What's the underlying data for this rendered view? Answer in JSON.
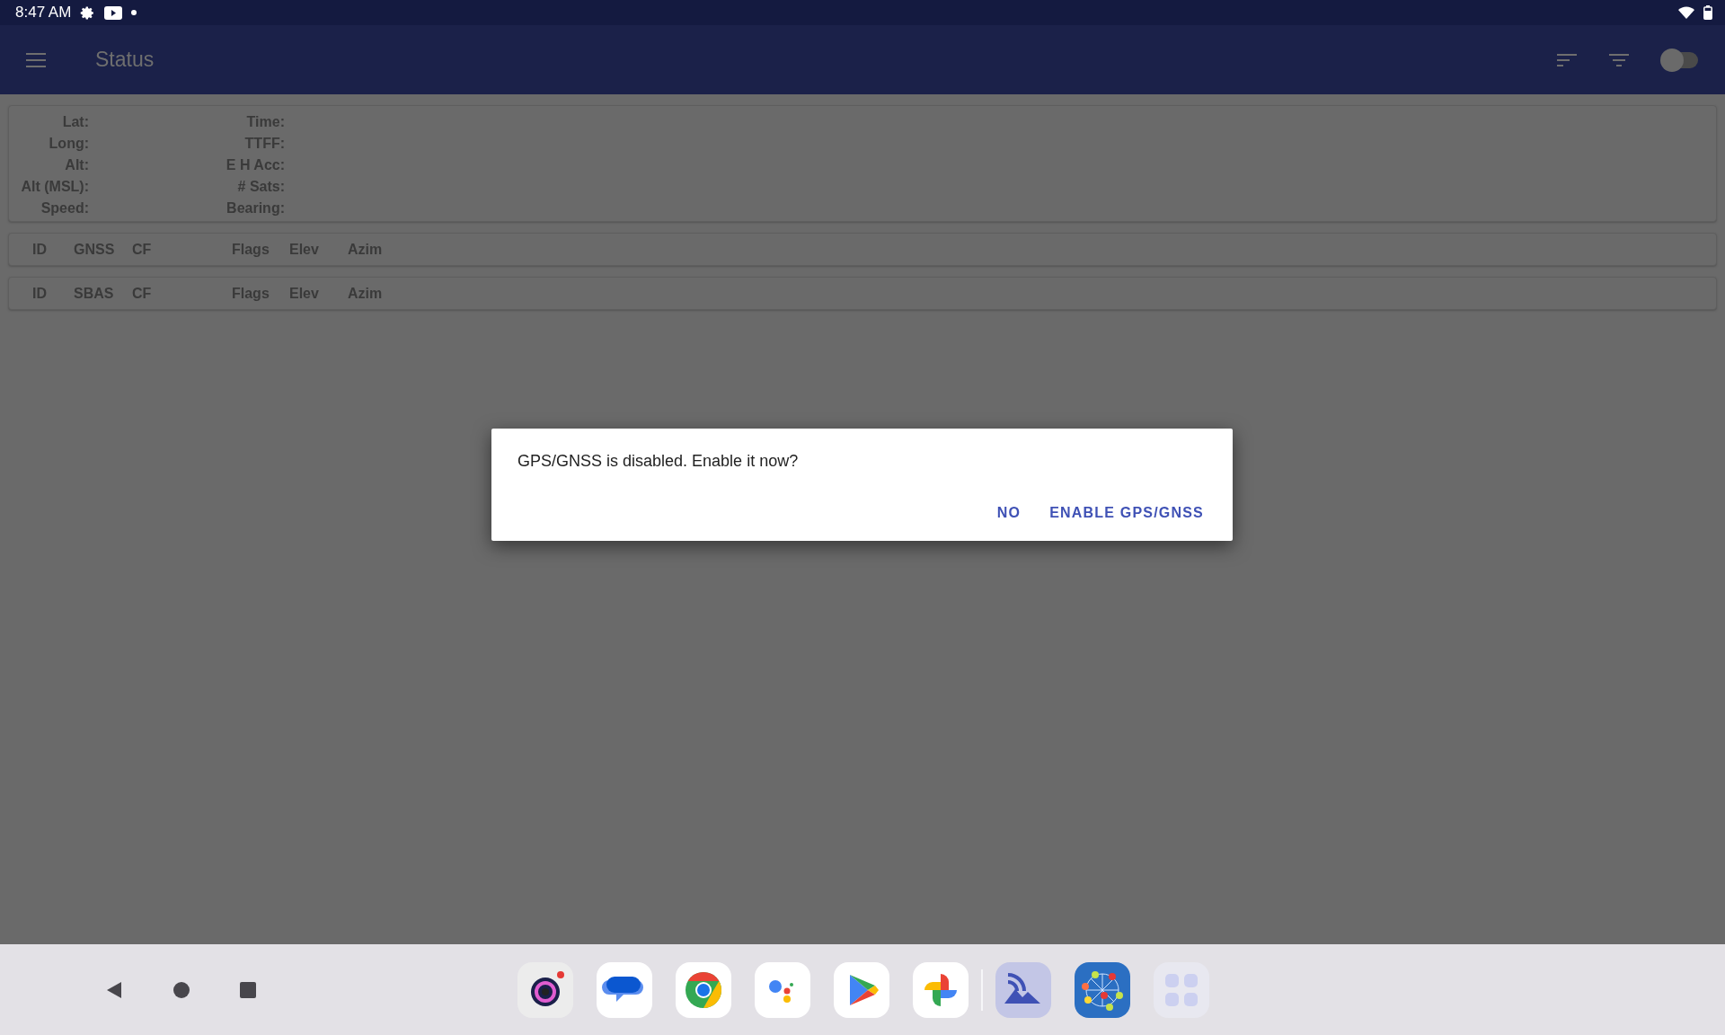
{
  "status_bar": {
    "time": "8:47 AM"
  },
  "app_bar": {
    "title": "Status",
    "toggle": {
      "on": false
    }
  },
  "location_panel": {
    "column_1": [
      "Lat:",
      "Long:",
      "Alt:",
      "Alt (MSL):",
      "Speed:"
    ],
    "column_2": [
      "Time:",
      "TTFF:",
      "E H Acc:",
      "# Sats:",
      "Bearing:"
    ]
  },
  "gnss_table": {
    "columns": [
      "ID",
      "GNSS",
      "CF",
      "Flags",
      "Elev",
      "Azim"
    ]
  },
  "sbas_table": {
    "columns": [
      "ID",
      "SBAS",
      "CF",
      "Flags",
      "Elev",
      "Azim"
    ]
  },
  "dialog": {
    "message": "GPS/GNSS is disabled. Enable it now?",
    "buttons": [
      "NO",
      "ENABLE GPS/GNSS"
    ]
  }
}
